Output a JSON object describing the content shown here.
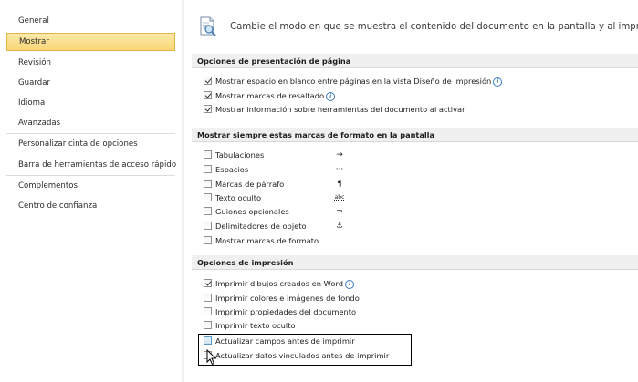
{
  "sidebar": {
    "items": [
      {
        "label": "General"
      },
      {
        "label": "Mostrar",
        "selected": true
      },
      {
        "label": "Revisión"
      },
      {
        "label": "Guardar"
      },
      {
        "label": "Idioma"
      },
      {
        "label": "Avanzadas"
      },
      {
        "label": "Personalizar cinta de opciones"
      },
      {
        "label": "Barra de herramientas de acceso rápido"
      },
      {
        "label": "Complementos"
      },
      {
        "label": "Centro de confianza"
      }
    ]
  },
  "header": {
    "icon": "document-magnifier-icon",
    "text": "Cambie el modo en que se muestra el contenido del documento en la pantalla y al imprimirlo."
  },
  "sections": [
    {
      "title": "Opciones de presentación de página",
      "options": [
        {
          "label": "Mostrar espacio en blanco entre páginas en la vista Diseño de impresión",
          "checked": true,
          "info": true
        },
        {
          "label": "Mostrar marcas de resaltado",
          "checked": true,
          "info": true
        },
        {
          "label": "Mostrar información sobre herramientas del documento al activar",
          "checked": true
        }
      ]
    },
    {
      "title": "Mostrar siempre estas marcas de formato en la pantalla",
      "options": [
        {
          "label": "Tabulaciones",
          "checked": false,
          "symbol": "→"
        },
        {
          "label": "Espacios",
          "checked": false,
          "symbol": "···"
        },
        {
          "label": "Marcas de párrafo",
          "checked": false,
          "symbol": "¶"
        },
        {
          "label": "Texto oculto",
          "checked": false,
          "symbol": "abc"
        },
        {
          "label": "Guiones opcionales",
          "checked": false,
          "symbol": "¬"
        },
        {
          "label": "Delimitadores de objeto",
          "checked": false,
          "symbol": "⚓"
        },
        {
          "label": "Mostrar marcas de formato",
          "checked": false
        }
      ]
    },
    {
      "title": "Opciones de impresión",
      "options": [
        {
          "label": "Imprimir dibujos creados en Word",
          "checked": true,
          "info": true
        },
        {
          "label": "Imprimir colores e imágenes de fondo",
          "checked": false
        },
        {
          "label": "Imprimir propiedades del documento",
          "checked": false
        },
        {
          "label": "Imprimir texto oculto",
          "checked": false
        },
        {
          "label": "Actualizar campos antes de imprimir",
          "checked": false,
          "hover": true
        },
        {
          "label": "Actualizar datos vinculados antes de imprimir",
          "checked": false
        }
      ]
    }
  ],
  "colors": {
    "selected_bg": "#f9d777",
    "selected_border": "#e3b446",
    "section_bg": "#f0f0f0",
    "info_blue": "#3a7cc4"
  }
}
